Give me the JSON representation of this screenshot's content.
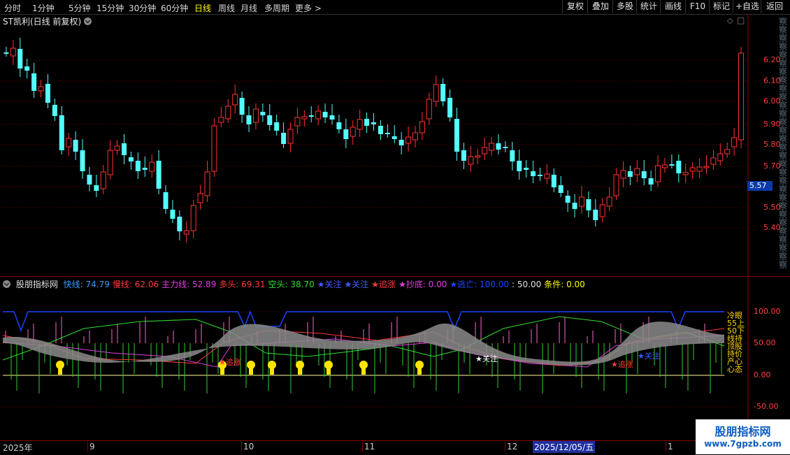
{
  "toolbar": {
    "timeframes": [
      "分时",
      "1分钟",
      "5分钟",
      "15分钟",
      "30分钟",
      "60分钟",
      "日线",
      "周线",
      "月线",
      "多周期",
      "更多 >"
    ],
    "active_timeframe": "日线",
    "right_buttons": [
      "复权",
      "叠加",
      "多股",
      "统计",
      "画线",
      "F10",
      "标记",
      "+自选",
      "返回"
    ]
  },
  "stock": {
    "title": "ST凯利(日线 前复权)"
  },
  "price_axis": {
    "ticks": [
      "6.20",
      "6.10",
      "6.00",
      "5.90",
      "5.80",
      "5.70",
      "5.50",
      "5.40"
    ],
    "current_price": "5.57"
  },
  "indicator": {
    "name": "股朋指标网",
    "items": [
      {
        "label": "快线: 74.79",
        "color": "#3b9bff"
      },
      {
        "label": "慢线: 62.06",
        "color": "#ff3a3a"
      },
      {
        "label": "主力线: 52.89",
        "color": "#e040e0"
      },
      {
        "label": "多头: 69.31",
        "color": "#ff3a3a"
      },
      {
        "label": "空头: 38.70",
        "color": "#33dd33"
      },
      {
        "label": "★关注",
        "color": "#3f5bff"
      },
      {
        "label": "★关注",
        "color": "#3f5bff"
      },
      {
        "label": "★追涨",
        "color": "#ff3a3a"
      },
      {
        "label": "★抄底: 0.00",
        "color": "#e040e0"
      },
      {
        "label": "★逃亡: 100.00",
        "color": "#1a44ff"
      },
      {
        "label": ": 50.00",
        "color": "#e0e0e0"
      },
      {
        "label": "条件: 0.00",
        "color": "#ffff00"
      }
    ],
    "axis_ticks": [
      "100.00",
      "50.00",
      "0.00",
      "-50.00"
    ],
    "chart_labels": {
      "guanzhu": "★关注",
      "zhuizhang1": "★追涨",
      "zhuizhang2": "★追涨",
      "guanzhu2": "★关注"
    },
    "side_text": [
      "冷眼",
      "55上",
      "50下",
      "线持",
      "顶股",
      "持价",
      "产心",
      "心态"
    ]
  },
  "time_axis": {
    "labels": [
      "2025年",
      "9",
      "10",
      "11",
      "12",
      "2025/12/05/五",
      "1"
    ]
  },
  "watermark": {
    "line1": "股朋指标网",
    "line2": "www.7gpzb.com"
  },
  "colors": {
    "up": "#ff3232",
    "down": "#54ffff",
    "bg": "#000000",
    "grid": "#5a0000"
  }
}
